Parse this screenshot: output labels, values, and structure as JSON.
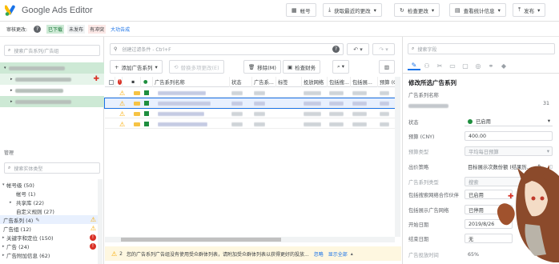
{
  "app": {
    "title": "Google Ads Editor"
  },
  "topbar": {
    "account_label": "帐号",
    "get_changes_label": "获取最近的更改",
    "check_changes_label": "检查更改",
    "stats_label": "查看统计信息",
    "publish_label": "发布"
  },
  "approval": {
    "label": "审核更改:",
    "chips": [
      "已下载",
      "未发布",
      "有冲突",
      "大功告成"
    ]
  },
  "left": {
    "search_placeholder": "搜索广告系列/广告组",
    "manage_label": "管理",
    "type_search_placeholder": "搜索实体类型",
    "tree": [
      {
        "label": "帐号级 (50)",
        "count": ""
      },
      {
        "label": "帐号 (1)",
        "count": ""
      },
      {
        "label": "共享库 (22)",
        "count": ""
      },
      {
        "label": "自定义规则 (27)",
        "count": ""
      },
      {
        "label": "广告系列 (4)",
        "count": ""
      },
      {
        "label": "广告组 (12)",
        "count": ""
      },
      {
        "label": "关键字和定位 (150)",
        "count": ""
      },
      {
        "label": "广告 (24)",
        "count": ""
      },
      {
        "label": "广告附加信息 (62)",
        "count": ""
      }
    ]
  },
  "middle": {
    "filter_placeholder": "创建过滤条件 - Ctrl+F",
    "add_campaign_label": "添加广告系列",
    "replace_label": "替换多项更改(E)",
    "delete_label": "移除(M)",
    "check_policy_label": "检查财务",
    "columns": [
      "广告系列名称",
      "状态",
      "广告系...",
      "标签",
      "投放网络",
      "包括搜...",
      "包括展...",
      "预算 (C"
    ],
    "row_count": 5,
    "warning_text": "您的广告系列广告组没有使用受众群体列表，请附加受众群体列表以获得更好的投放...",
    "warning_count": "2",
    "ignore_label": "忽略",
    "show_all_label": "显示全部"
  },
  "right": {
    "search_placeholder": "搜索字段",
    "title": "修改所选广告系列",
    "name_label": "广告系列名称",
    "name_counter": "31",
    "status_label": "状态",
    "status_value": "已启用",
    "budget_label": "预算 (CNY)",
    "budget_value": "400.00",
    "budget_type_label": "预算类型",
    "budget_type_value": "平均每日预算",
    "bid_label": "出价策略",
    "bid_value": "目标展示次数份额 (结果历...",
    "campaign_type_label": "广告系列类型",
    "campaign_type_value": "搜索",
    "search_partner_label": "包括搜索网络合作伙伴",
    "search_partner_value": "已启用",
    "display_label": "包括展示广告网络",
    "display_value": "已停用",
    "start_label": "开始日期",
    "start_value": "2019/8/26",
    "end_label": "结束日期",
    "end_value": "无",
    "imp_label": "广告投放时间",
    "imp_value": "65%"
  },
  "colors": {
    "accent": "#1a73e8",
    "enabled": "#1e8e3e",
    "warning": "#f9ab00",
    "error": "#d93025"
  }
}
